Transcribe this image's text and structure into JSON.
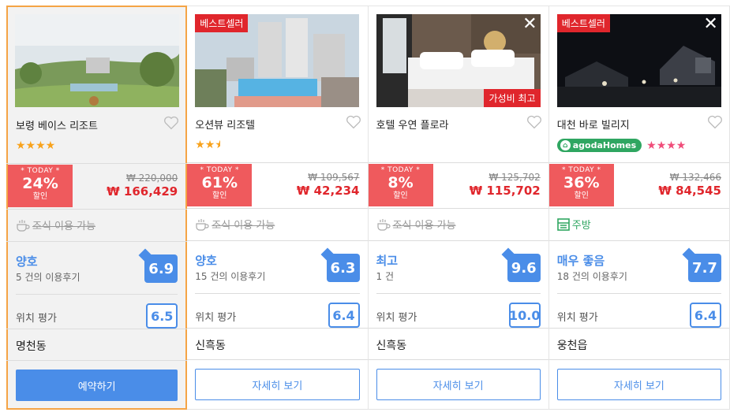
{
  "cards": [
    {
      "name": "보령 베이스 리조트",
      "rating_display": "★★★★",
      "today_label": "* TODAY *",
      "discount": "24%",
      "discount_sub": "할인",
      "old_price": "₩ 220,000",
      "new_price": "₩ 166,429",
      "amenity": "조식 이용 가능",
      "review_label": "양호",
      "review_count": "5 건의 이용후기",
      "score": "6.9",
      "location_label": "위치 평가",
      "location_score": "6.5",
      "area": "명천동",
      "button": "예약하기"
    },
    {
      "badge": "베스트셀러",
      "name": "오션뷰 리조텔",
      "rating_display": "★★",
      "rating_half": "★",
      "today_label": "* TODAY *",
      "discount": "61%",
      "discount_sub": "할인",
      "old_price": "₩ 109,567",
      "new_price": "₩ 42,234",
      "amenity": "조식 이용 가능",
      "review_label": "양호",
      "review_count": "15 건의 이용후기",
      "score": "6.3",
      "location_label": "위치 평가",
      "location_score": "6.4",
      "area": "신흑동",
      "button": "자세히 보기"
    },
    {
      "badge": "가성비 최고",
      "close": "✕",
      "name": "호텔 우연 플로라",
      "today_label": "* TODAY *",
      "discount": "8%",
      "discount_sub": "할인",
      "old_price": "₩ 125,702",
      "new_price": "₩ 115,702",
      "amenity": "조식 이용 가능",
      "review_label": "최고",
      "review_count": "1 건",
      "score": "9.6",
      "location_label": "위치 평가",
      "location_score": "10.0",
      "area": "신흑동",
      "button": "자세히 보기"
    },
    {
      "badge": "베스트셀러",
      "close": "✕",
      "name": "대천 바로 빌리지",
      "agoda_homes": "agodaHomes",
      "rating_display": "★★★★",
      "today_label": "* TODAY *",
      "discount": "36%",
      "discount_sub": "할인",
      "old_price": "₩ 132,466",
      "new_price": "₩ 84,545",
      "amenity": "주방",
      "review_label": "매우 좋음",
      "review_count": "18 건의 이용후기",
      "score": "7.7",
      "location_label": "위치 평가",
      "location_score": "6.4",
      "area": "웅천읍",
      "button": "자세히 보기"
    }
  ],
  "colors": {
    "accent": "#4a8de8",
    "deal": "#ef5a5d",
    "price": "#e0262c",
    "selected_border": "#f5a445",
    "star": "#f8a21b",
    "agoda": "#2fa661"
  }
}
